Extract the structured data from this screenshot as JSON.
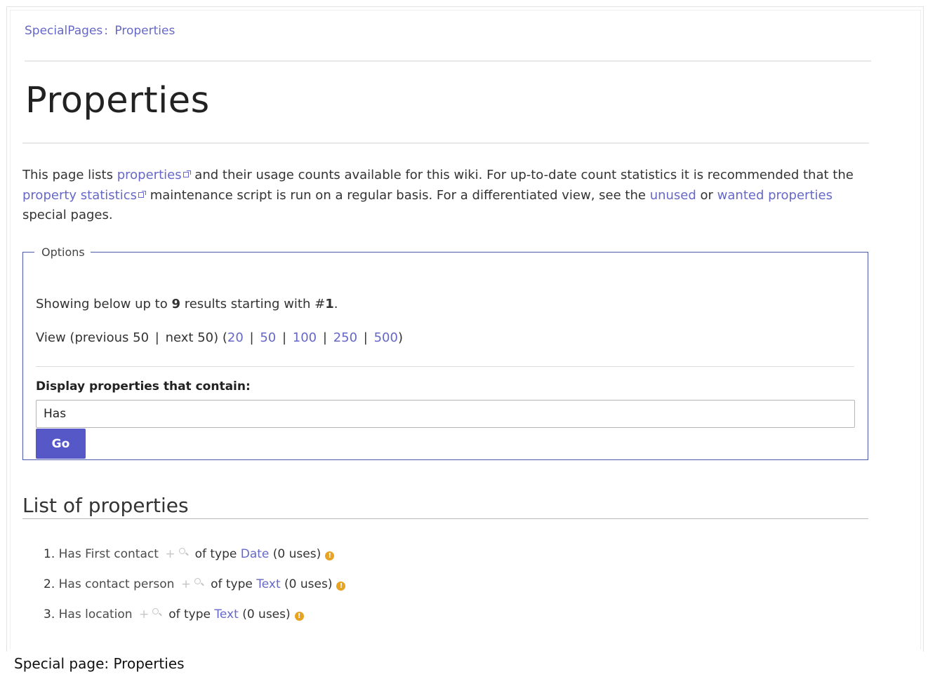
{
  "breadcrumb": {
    "parent": "SpecialPages",
    "separator": ":",
    "current": "Properties"
  },
  "page_title": "Properties",
  "intro": {
    "t1": "This page lists ",
    "link_properties": "properties",
    "t2": " and their usage counts available for this wiki. For up-to-date count statistics it is recommended that the ",
    "link_property_statistics": "property statistics",
    "t3": " maintenance script is run on a regular basis. For a differentiated view, see the ",
    "link_unused": "unused",
    "t4": " or ",
    "link_wanted": "wanted properties",
    "t5": " special pages."
  },
  "options": {
    "legend": "Options",
    "showing_prefix": "Showing below up to ",
    "showing_count": "9",
    "showing_mid": " results starting with #",
    "showing_start": "1",
    "showing_suffix": ".",
    "view_prefix": "View (previous 50",
    "view_pipe": "|",
    "view_next": "next 50) (",
    "limits": [
      "20",
      "50",
      "100",
      "250",
      "500"
    ],
    "view_close": ")",
    "filter_label": "Display properties that contain:",
    "filter_value": "Has",
    "go_label": "Go"
  },
  "list_title": "List of properties",
  "properties": [
    {
      "index": "1.",
      "name": "Has First contact",
      "add": "+",
      "of_type": "of type",
      "type": "Date",
      "uses": "(0 uses)",
      "warn": "!"
    },
    {
      "index": "2.",
      "name": "Has contact person",
      "add": "+",
      "of_type": "of type",
      "type": "Text",
      "uses": "(0 uses)",
      "warn": "!"
    },
    {
      "index": "3.",
      "name": "Has location",
      "add": "+",
      "of_type": "of type",
      "type": "Text",
      "uses": "(0 uses)",
      "warn": "!"
    }
  ],
  "caption": "Special page: Properties",
  "colors": {
    "link": "#6668c7",
    "button": "#5658c8",
    "warning": "#e7a323",
    "fieldset_border": "#4a5aa8"
  },
  "icons": [
    "external-link-icon",
    "add-icon",
    "search-icon",
    "warning-icon"
  ]
}
